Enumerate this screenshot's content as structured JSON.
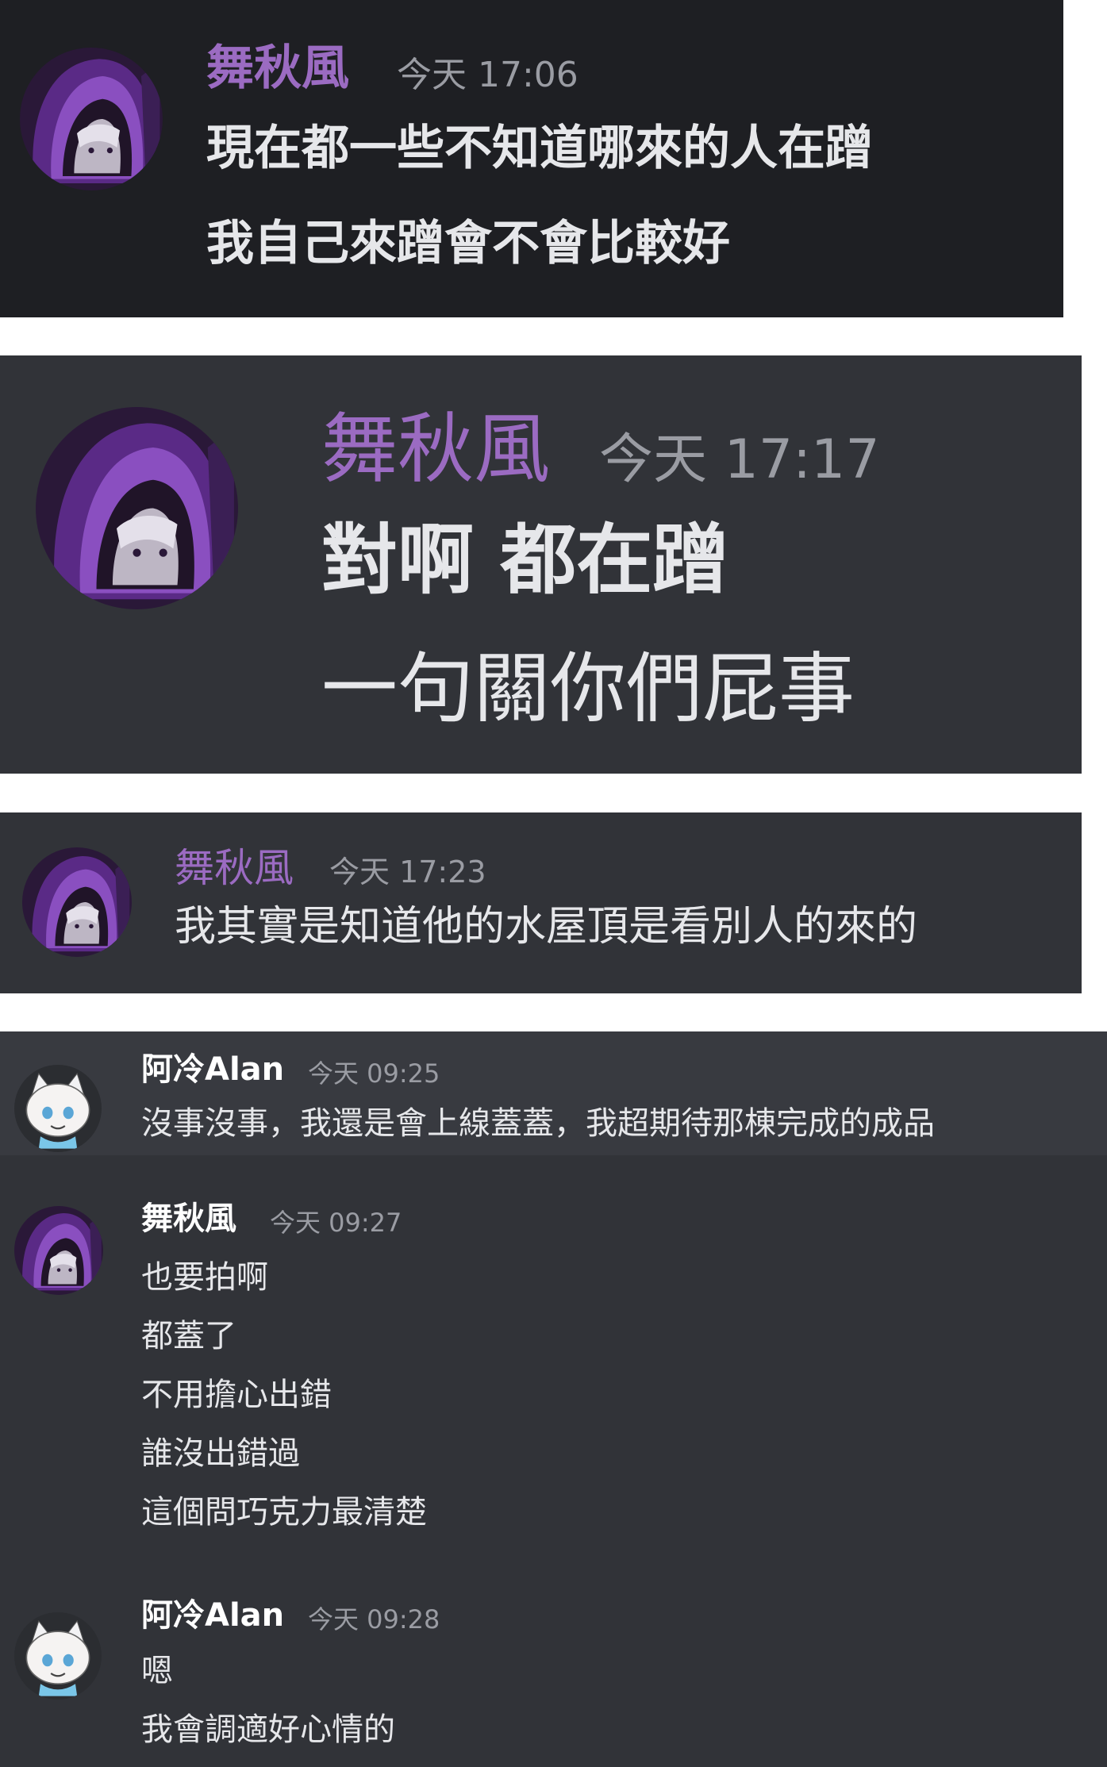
{
  "colors": {
    "panel_dark": "#1e1f23",
    "panel_gray": "#313338",
    "panel_highlight": "#383a40",
    "username_purple": "#9b6bc2",
    "username_white": "#ffffff",
    "timestamp": "#9a9ca3",
    "text": "#e6e7ea"
  },
  "panels": [
    {
      "messages": [
        {
          "avatar": "purple-hood-avatar",
          "username": "舞秋風",
          "timestamp": "今天 17:06",
          "lines": [
            "現在都一些不知道哪來的人在蹭",
            "我自己來蹭會不會比較好"
          ]
        }
      ]
    },
    {
      "messages": [
        {
          "avatar": "purple-hood-avatar",
          "username": "舞秋風",
          "timestamp": "今天 17:17",
          "lines": [
            "對啊 都在蹭",
            "一句關你們屁事"
          ]
        }
      ]
    },
    {
      "messages": [
        {
          "avatar": "purple-hood-avatar",
          "username": "舞秋風",
          "timestamp": "今天 17:23",
          "lines": [
            "我其實是知道他的水屋頂是看別人的來的"
          ]
        }
      ]
    },
    {
      "messages": [
        {
          "avatar": "white-cat-avatar",
          "username": "阿冷Alan",
          "timestamp": "今天 09:25",
          "lines": [
            "沒事沒事，我還是會上線蓋蓋，我超期待那棟完成的成品"
          ]
        },
        {
          "avatar": "purple-hood-avatar",
          "username": "舞秋風",
          "timestamp": "今天 09:27",
          "lines": [
            "也要拍啊",
            "都蓋了",
            "不用擔心出錯",
            "誰沒出錯過",
            "這個問巧克力最清楚"
          ]
        },
        {
          "avatar": "white-cat-avatar",
          "username": "阿冷Alan",
          "timestamp": "今天 09:28",
          "lines": [
            "嗯",
            "我會調適好心情的"
          ]
        }
      ]
    }
  ]
}
